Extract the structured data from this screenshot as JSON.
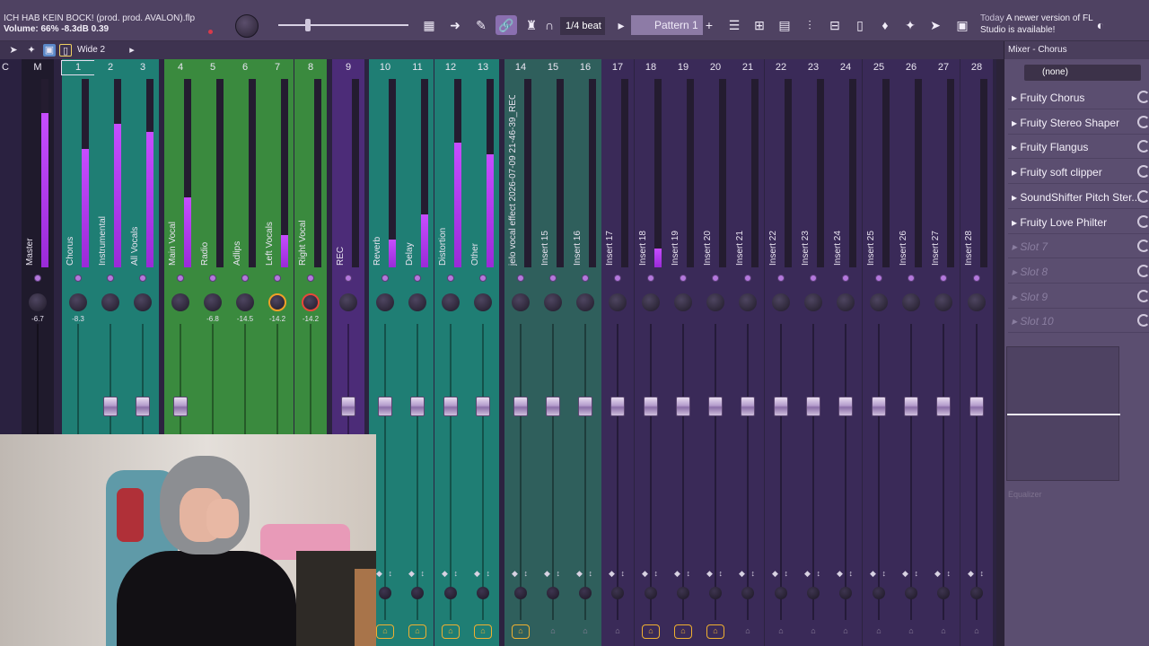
{
  "top": {
    "project_title": "ICH HAB KEIN BOCK! (prod. prod. AVALON).flp",
    "status": "Volume: 66%  -8.3dB  0.39",
    "snap": "1/4 beat",
    "pattern": "Pattern 1",
    "news_today": "Today",
    "news_text": "A newer version of FL Studio is available!"
  },
  "row2": {
    "preset": "Wide 2"
  },
  "mixer": {
    "strips": [
      {
        "num": "C",
        "name": "",
        "pan": "",
        "color": "#2a2140"
      },
      {
        "num": "M",
        "name": "Master",
        "pan": "-6.7",
        "color": "#1f1a2c"
      },
      {
        "num": "1",
        "name": "Chorus",
        "pan": "-8.3",
        "color": "#1f7e74"
      },
      {
        "num": "2",
        "name": "Instrumental",
        "pan": "",
        "color": "#1f7e74"
      },
      {
        "num": "3",
        "name": "All Vocals",
        "pan": "",
        "color": "#1f7e74"
      },
      {
        "num": "4",
        "name": "Main Vocal",
        "pan": "",
        "color": "#3a8a3e"
      },
      {
        "num": "5",
        "name": "Radio",
        "pan": "-6.8",
        "color": "#3a8a3e"
      },
      {
        "num": "6",
        "name": "Adlips",
        "pan": "-14.5",
        "color": "#3a8a3e"
      },
      {
        "num": "7",
        "name": "Left Vocals",
        "pan": "-14.2",
        "color": "#3a8a3e"
      },
      {
        "num": "8",
        "name": "Right Vocal",
        "pan": "-14.2",
        "color": "#3a8a3e"
      },
      {
        "num": "9",
        "name": "REC",
        "pan": "",
        "color": "#4c2c78"
      },
      {
        "num": "10",
        "name": "Reverb",
        "pan": "",
        "color": "#1f7e74"
      },
      {
        "num": "11",
        "name": "Delay",
        "pan": "",
        "color": "#1f7e74"
      },
      {
        "num": "12",
        "name": "Distortion",
        "pan": "",
        "color": "#1f7e74"
      },
      {
        "num": "13",
        "name": "Other",
        "pan": "",
        "color": "#1f7e74"
      },
      {
        "num": "14",
        "name": "jelo vocal effect 2026-07-09 21-46-39_REC",
        "pan": "",
        "color": "#2f5f5c"
      },
      {
        "num": "15",
        "name": "Insert 15",
        "pan": "",
        "color": "#2f5f5c"
      },
      {
        "num": "16",
        "name": "Insert 16",
        "pan": "",
        "color": "#2f5f5c"
      },
      {
        "num": "17",
        "name": "Insert 17",
        "pan": "",
        "color": "#3a2a58"
      },
      {
        "num": "18",
        "name": "Insert 18",
        "pan": "",
        "color": "#3a2a58"
      },
      {
        "num": "19",
        "name": "Insert 19",
        "pan": "",
        "color": "#3a2a58"
      },
      {
        "num": "20",
        "name": "Insert 20",
        "pan": "",
        "color": "#3a2a58"
      },
      {
        "num": "21",
        "name": "Insert 21",
        "pan": "",
        "color": "#3a2a58"
      },
      {
        "num": "22",
        "name": "Insert 22",
        "pan": "",
        "color": "#3a2a58"
      },
      {
        "num": "23",
        "name": "Insert 23",
        "pan": "",
        "color": "#3a2a58"
      },
      {
        "num": "24",
        "name": "Insert 24",
        "pan": "",
        "color": "#3a2a58"
      },
      {
        "num": "25",
        "name": "Insert 25",
        "pan": "",
        "color": "#3a2a58"
      },
      {
        "num": "26",
        "name": "Insert 26",
        "pan": "",
        "color": "#3a2a58"
      },
      {
        "num": "27",
        "name": "Insert 27",
        "pan": "",
        "color": "#3a2a58"
      },
      {
        "num": "28",
        "name": "Insert 28",
        "pan": "",
        "color": "#3a2a58"
      }
    ],
    "meter_levels": [
      0.0,
      0.82,
      0.63,
      0.76,
      0.72,
      0.37,
      0.0,
      0.0,
      0.17,
      0.0,
      0.0,
      0.15,
      0.28,
      0.66,
      0.6,
      0.0,
      0.0,
      0.0,
      0.0,
      0.1,
      0.0,
      0.0,
      0.0,
      0.0,
      0.0,
      0.0,
      0.0,
      0.0,
      0.0,
      0.0
    ],
    "fader_levels": [
      0.0,
      0.1,
      0.0,
      0.42,
      0.42,
      0.42,
      0.1,
      0.0,
      0.0,
      0.0,
      0.42,
      0.42,
      0.42,
      0.42,
      0.42,
      0.42,
      0.42,
      0.42,
      0.42,
      0.42,
      0.42,
      0.42,
      0.42,
      0.42,
      0.42,
      0.42,
      0.42,
      0.42,
      0.42,
      0.42
    ],
    "rec_armed": [
      false,
      false,
      false,
      false,
      false,
      false,
      false,
      false,
      false,
      false,
      false,
      true,
      true,
      true,
      true,
      true,
      false,
      false,
      false,
      true,
      true,
      true,
      false,
      false,
      false,
      false,
      false,
      false,
      false,
      false
    ],
    "colors": {
      "selected_strip_outline": "#e6e0f0",
      "meter": "#c64dff",
      "rec_arm": "#f0b030"
    }
  },
  "panel": {
    "title": "Mixer - Chorus",
    "preset": "(none)",
    "slots": [
      {
        "label": "Fruity Chorus",
        "empty": false
      },
      {
        "label": "Fruity Stereo Shaper",
        "empty": false
      },
      {
        "label": "Fruity Flangus",
        "empty": false
      },
      {
        "label": "Fruity soft clipper",
        "empty": false
      },
      {
        "label": "SoundShifter Pitch Ster...",
        "empty": false
      },
      {
        "label": "Fruity Love Philter",
        "empty": false
      },
      {
        "label": "Slot 7",
        "empty": true
      },
      {
        "label": "Slot 8",
        "empty": true
      },
      {
        "label": "Slot 9",
        "empty": true
      },
      {
        "label": "Slot 10",
        "empty": true
      }
    ],
    "eq_label": "Equalizer"
  }
}
